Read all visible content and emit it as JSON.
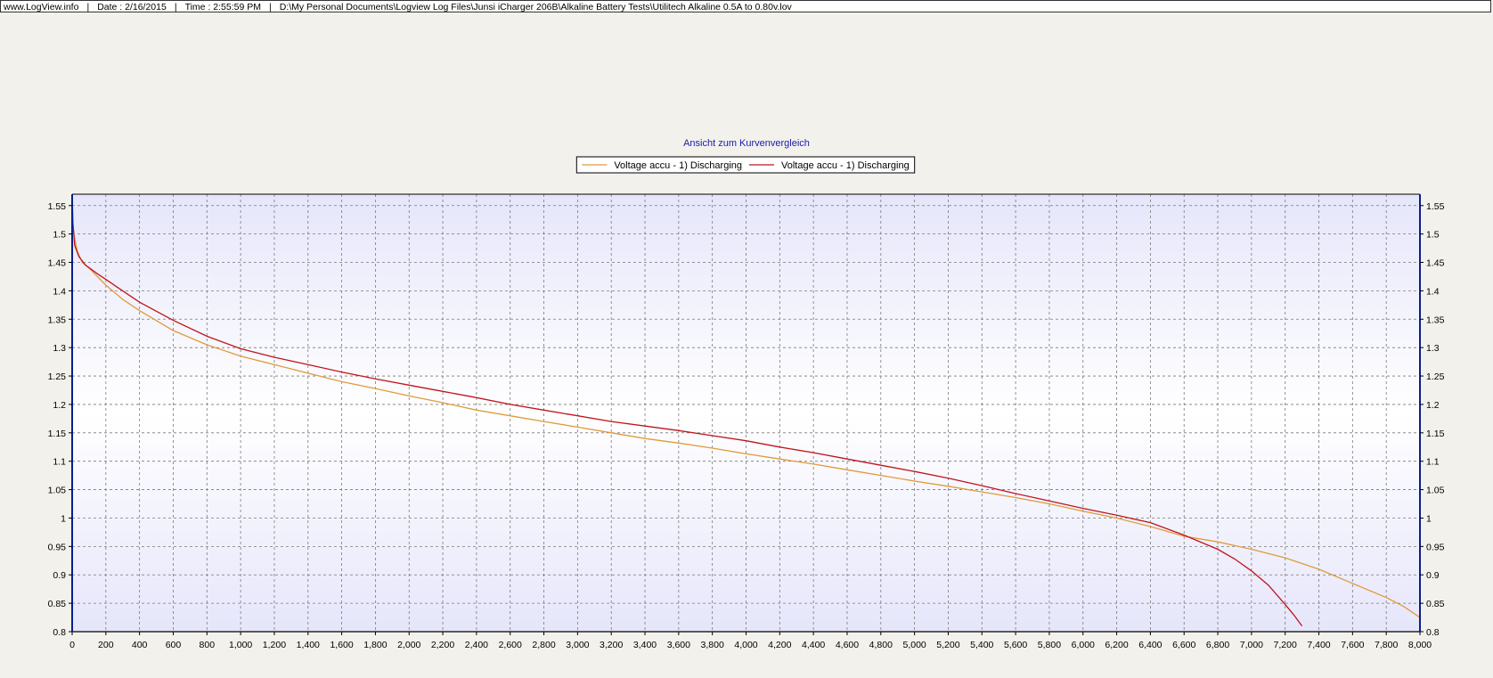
{
  "header": {
    "site": "www.LogView.info",
    "date": "Date : 2/16/2015",
    "time": "Time : 2:55:59 PM",
    "file": "D:\\My Personal Documents\\Logview Log Files\\Junsi iCharger 206B\\Alkaline Battery Tests\\Utilitech Alkaline 0.5A to 0.80v.lov"
  },
  "colors": {
    "series1": "#e09a3a",
    "series2": "#c0141c",
    "plot_bg_edge": "#e6e6fb",
    "plot_bg_center": "#ffffff",
    "grid": "#7a7a7a",
    "title": "#1a1ab0",
    "frame": "#0a1e8c"
  },
  "chart_data": {
    "type": "line",
    "title": "Ansicht zum Kurvenvergleich",
    "xlabel": "",
    "ylabel": "",
    "xlim": [
      0,
      8000
    ],
    "ylim": [
      0.8,
      1.57
    ],
    "grid": true,
    "legend_position": "top-center",
    "x_ticks": [
      0,
      200,
      400,
      600,
      800,
      1000,
      1200,
      1400,
      1600,
      1800,
      2000,
      2200,
      2400,
      2600,
      2800,
      3000,
      3200,
      3400,
      3600,
      3800,
      4000,
      4200,
      4400,
      4600,
      4800,
      5000,
      5200,
      5400,
      5600,
      5800,
      6000,
      6200,
      6400,
      6600,
      6800,
      7000,
      7200,
      7400,
      7600,
      7800,
      8000
    ],
    "x_tick_labels": [
      "0",
      "200",
      "400",
      "600",
      "800",
      "1,000",
      "1,200",
      "1,400",
      "1,600",
      "1,800",
      "2,000",
      "2,200",
      "2,400",
      "2,600",
      "2,800",
      "3,000",
      "3,200",
      "3,400",
      "3,600",
      "3,800",
      "4,000",
      "4,200",
      "4,400",
      "4,600",
      "4,800",
      "5,000",
      "5,200",
      "5,400",
      "5,600",
      "5,800",
      "6,000",
      "6,200",
      "6,400",
      "6,600",
      "6,800",
      "7,000",
      "7,200",
      "7,400",
      "7,600",
      "7,800",
      "8,000"
    ],
    "y_ticks": [
      0.8,
      0.85,
      0.9,
      0.95,
      1,
      1.05,
      1.1,
      1.15,
      1.2,
      1.25,
      1.3,
      1.35,
      1.4,
      1.45,
      1.5,
      1.55
    ],
    "y_tick_labels": [
      "0.8",
      "0.85",
      "0.9",
      "0.95",
      "1",
      "1.05",
      "1.1",
      "1.15",
      "1.2",
      "1.25",
      "1.3",
      "1.35",
      "1.4",
      "1.45",
      "1.5",
      "1.55"
    ],
    "series": [
      {
        "name": "Voltage accu - 1) Discharging",
        "x": [
          0,
          10,
          30,
          60,
          100,
          200,
          300,
          400,
          600,
          800,
          1000,
          1200,
          1400,
          1600,
          1800,
          2000,
          2200,
          2400,
          2600,
          2800,
          3000,
          3200,
          3400,
          3600,
          3800,
          4000,
          4200,
          4400,
          4600,
          4800,
          5000,
          5200,
          5400,
          5600,
          5800,
          6000,
          6200,
          6400,
          6600,
          6800,
          7000,
          7200,
          7400,
          7600,
          7800,
          7900,
          8000
        ],
        "y": [
          1.53,
          1.5,
          1.47,
          1.45,
          1.44,
          1.41,
          1.385,
          1.365,
          1.33,
          1.305,
          1.285,
          1.27,
          1.255,
          1.24,
          1.228,
          1.215,
          1.203,
          1.19,
          1.18,
          1.17,
          1.16,
          1.15,
          1.14,
          1.132,
          1.123,
          1.113,
          1.104,
          1.095,
          1.085,
          1.075,
          1.065,
          1.056,
          1.046,
          1.036,
          1.025,
          1.012,
          1.0,
          0.985,
          0.968,
          0.958,
          0.945,
          0.93,
          0.91,
          0.885,
          0.86,
          0.845,
          0.825
        ]
      },
      {
        "name": "Voltage accu - 1) Discharging",
        "x": [
          0,
          5,
          15,
          40,
          80,
          150,
          200,
          300,
          400,
          600,
          800,
          1000,
          1200,
          1400,
          1600,
          1800,
          2000,
          2200,
          2400,
          2600,
          2800,
          3000,
          3200,
          3400,
          3600,
          3800,
          4000,
          4200,
          4400,
          4600,
          4800,
          5000,
          5200,
          5400,
          5600,
          5800,
          6000,
          6200,
          6400,
          6600,
          6800,
          6900,
          7000,
          7100,
          7200,
          7250,
          7300
        ],
        "y": [
          1.57,
          1.52,
          1.48,
          1.46,
          1.445,
          1.43,
          1.42,
          1.4,
          1.38,
          1.348,
          1.32,
          1.298,
          1.283,
          1.27,
          1.257,
          1.245,
          1.234,
          1.223,
          1.212,
          1.2,
          1.19,
          1.18,
          1.17,
          1.162,
          1.154,
          1.145,
          1.136,
          1.125,
          1.115,
          1.104,
          1.093,
          1.082,
          1.07,
          1.057,
          1.043,
          1.03,
          1.017,
          1.005,
          0.992,
          0.97,
          0.945,
          0.928,
          0.907,
          0.882,
          0.848,
          0.83,
          0.81
        ]
      }
    ]
  }
}
